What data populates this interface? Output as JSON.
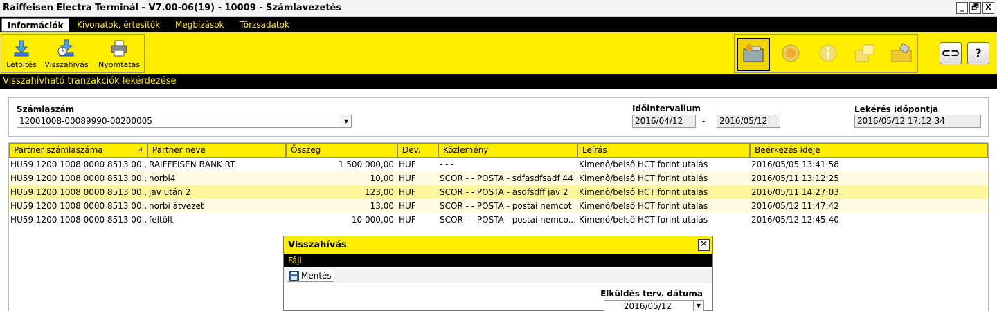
{
  "window": {
    "title": "Raiffeisen Electra Terminál - V7.00-06(19) - 10009 - Számlavezetés",
    "minimize": "_",
    "restore": "🗗",
    "close": "X"
  },
  "menu": {
    "items": [
      {
        "label": "Információk",
        "active": true
      },
      {
        "label": "Kivonatok, értesítők",
        "active": false
      },
      {
        "label": "Megbízások",
        "active": false
      },
      {
        "label": "Törzsadatok",
        "active": false
      }
    ]
  },
  "toolbar": {
    "download": "Letöltés",
    "recall": "Visszahívás",
    "print": "Nyomtatás",
    "link_btn": "⊂⊃",
    "help_btn": "?"
  },
  "section": {
    "title": "Visszahívható tranzakciók lekérdezése"
  },
  "filter": {
    "account_label": "Számlaszám",
    "account_value": "12001008-00089990-00200005",
    "interval_label": "Időintervallum",
    "date_from": "2016/04/12",
    "date_sep": "-",
    "date_to": "2016/05/12",
    "query_time_label": "Lekérés időpontja",
    "query_time": "2016/05/12 17:12:34"
  },
  "table": {
    "columns": [
      "Partner számlaszáma",
      "Partner neve",
      "Összeg",
      "Dev.",
      "Közlemény",
      "Leírás",
      "Beérkezés ideje"
    ],
    "rows": [
      [
        "HU59 1200 1008 0000 8513 00...",
        "RAIFFEISEN BANK RT.",
        "1 500 000,00",
        "HUF",
        "- - -",
        "Kimenő/belső HCT forint utalás",
        "2016/05/05 13:41:58"
      ],
      [
        "HU59 1200 1008 0000 8513 00...",
        "norbi4",
        "10,00",
        "HUF",
        "SCOR -  - POSTA - sdfasdfsadf 44",
        "Kimenő/belső HCT forint utalás",
        "2016/05/11 13:12:25"
      ],
      [
        "HU59 1200 1008 0000 8513 00...",
        "jav után 2",
        "123,00",
        "HUF",
        "SCOR -  - POSTA - asdfsdff jav 2",
        "Kimenő/belső HCT forint utalás",
        "2016/05/11 14:27:03"
      ],
      [
        "HU59 1200 1008 0000 8513 00...",
        "norbi átvezet",
        "13,00",
        "HUF",
        "SCOR -  - POSTA - postai nemcot",
        "Kimenő/belső HCT forint utalás",
        "2016/05/12 11:47:42"
      ],
      [
        "HU59 1200 1008 0000 8513 00...",
        "feltölt",
        "10 000,00",
        "HUF",
        "SCOR -  - POSTA - postai nemco...",
        "Kimenő/belső HCT forint utalás",
        "2016/05/12 12:45:40"
      ]
    ]
  },
  "dialog": {
    "title": "Visszahívás",
    "close": "✕",
    "menu_file": "Fájl",
    "save": "Mentés",
    "date_label": "Elküldés terv. dátuma",
    "date_value": "2016/05/12"
  },
  "colors": {
    "accent_yellow": "#ffed00",
    "menu_text": "#ffe600",
    "bar_black": "#000000"
  }
}
